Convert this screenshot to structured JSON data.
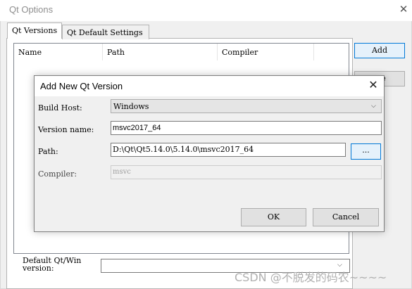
{
  "outer_window": {
    "title": "Qt Options",
    "close_glyph": "✕",
    "tabs": [
      {
        "label": "Qt Versions",
        "selected": true
      },
      {
        "label": "Qt Default Settings",
        "selected": false
      }
    ],
    "tree_headers": [
      "Name",
      "Path",
      "Compiler"
    ],
    "add_label": "Add",
    "remove_label": "ete",
    "default_label": "Default Qt/Win version:",
    "default_value": "",
    "combo_arrow": "⌵"
  },
  "dialog": {
    "title": "Add New Qt Version",
    "close_glyph": "✕",
    "build_host_label": "Build Host:",
    "build_host_value": "Windows",
    "version_name_label": "Version name:",
    "version_name_value": "msvc2017_64",
    "path_label": "Path:",
    "path_value": "D:\\Qt\\Qt5.14.0\\5.14.0\\msvc2017_64",
    "browse_label": "...",
    "compiler_label": "Compiler:",
    "compiler_value": "msvc",
    "ok_label": "OK",
    "cancel_label": "Cancel",
    "combo_arrow": "⌵"
  },
  "watermark": "CSDN @不脱发的码农~~~~",
  "colors": {
    "accent": "#0078d7",
    "window_bg": "#f0f0f0"
  }
}
